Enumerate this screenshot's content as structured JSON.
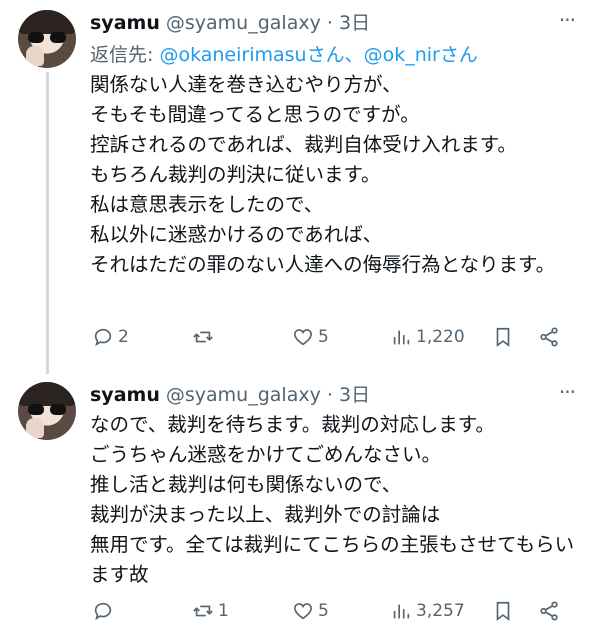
{
  "tweets": [
    {
      "name": "syamu",
      "handle": "@syamu_galaxy",
      "sep": "·",
      "time": "3日",
      "more": "···",
      "reply_label": "返信先: ",
      "reply_targets": "@okaneirimasuさん、@ok_nirさん",
      "text": "関係ない人達を巻き込むやり方が、\nそもそも間違ってると思うのですが。\n控訴されるのであれば、裁判自体受け入れます。\nもちろん裁判の判決に従います。\n私は意思表示をしたので、\n私以外に迷惑かけるのであれば、\nそれはただの罪のない人達への侮辱行為となります。",
      "replies": "2",
      "retweets": "",
      "likes": "5",
      "views": "1,220"
    },
    {
      "name": "syamu",
      "handle": "@syamu_galaxy",
      "sep": "·",
      "time": "3日",
      "more": "···",
      "text": "なので、裁判を待ちます。裁判の対応します。\nごうちゃん迷惑をかけてごめんなさい。\n推し活と裁判は何も関係ないので、\n裁判が決まった以上、裁判外での討論は\n無用です。全ては裁判にてこちらの主張もさせてもらいます故",
      "replies": "",
      "retweets": "1",
      "likes": "5",
      "views": "3,257"
    }
  ],
  "icons": [
    "reply-icon",
    "retweet-icon",
    "like-icon",
    "views-icon",
    "bookmark-icon",
    "share-icon",
    "more-icon"
  ]
}
